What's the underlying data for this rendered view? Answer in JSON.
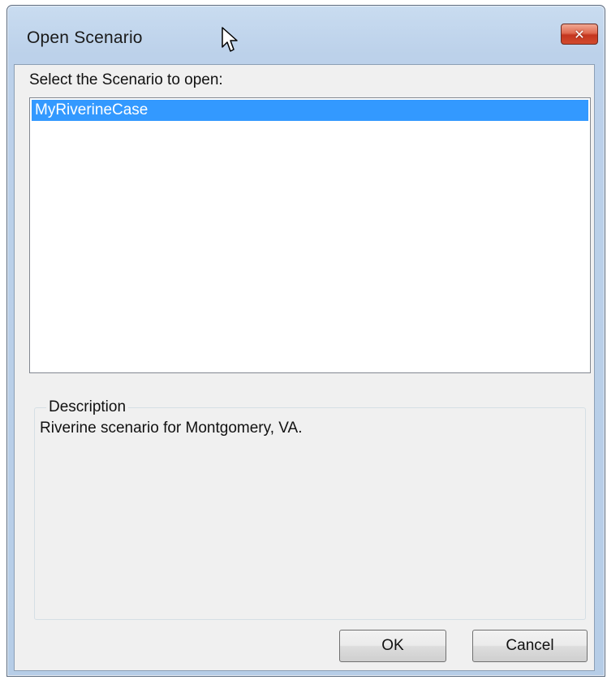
{
  "dialog": {
    "title": "Open Scenario",
    "close_icon": "close-icon",
    "close_glyph": "✕",
    "prompt": "Select the Scenario to open:",
    "scenarios": [
      "MyRiverineCase"
    ],
    "selected_index": 0,
    "description_label": "Description",
    "description_text": "Riverine scenario for Montgomery, VA.",
    "ok_label": "OK",
    "cancel_label": "Cancel"
  },
  "colors": {
    "selection": "#3399ff",
    "dialog_background": "#f0f0f0",
    "close_button": "#d24a2e"
  },
  "cursor_icon": "arrow-cursor-icon"
}
